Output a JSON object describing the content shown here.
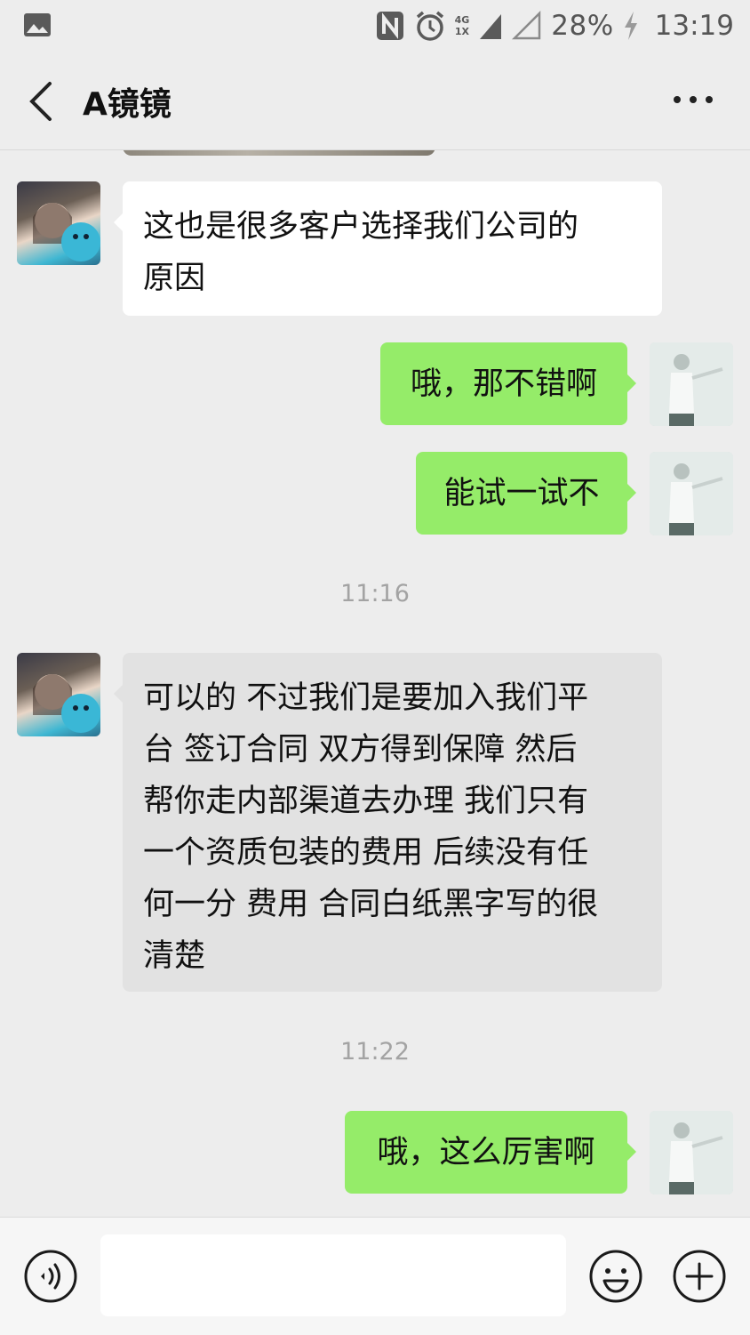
{
  "status_bar": {
    "network_label_top": "4G",
    "network_label_bottom": "1X",
    "battery": "28%",
    "time": "13:19",
    "icons": [
      "gallery-icon",
      "nfc-icon",
      "alarm-icon",
      "signal-icon",
      "signal-empty-icon",
      "charging-icon"
    ]
  },
  "header": {
    "title": "A镜镜"
  },
  "messages": [
    {
      "from": "them",
      "text": "这也是很多客户选择我们公司的原因"
    },
    {
      "from": "me",
      "text": "哦，那不错啊"
    },
    {
      "from": "me",
      "text": "能试一试不"
    },
    {
      "timestamp": "11:16"
    },
    {
      "from": "them",
      "text": "可以的 不过我们是要加入我们平台 签订合同 双方得到保障 然后帮你走内部渠道去办理 我们只有一个资质包装的费用 后续没有任何一分 费用 合同白纸黑字写的很清楚"
    },
    {
      "timestamp": "11:22"
    },
    {
      "from": "me",
      "text": "哦，这么厉害啊"
    }
  ],
  "msg": {
    "m1_l1": "这也是很多客户选择我们公司的",
    "m1_l2": "原因",
    "m2": "哦，那不错啊",
    "m3": "能试一试不",
    "ts1": "11:16",
    "m4_l1": "可以的 不过我们是要加入我们平",
    "m4_l2": "台 签订合同 双方得到保障 然后",
    "m4_l3": "帮你走内部渠道去办理 我们只有",
    "m4_l4": "一个资质包装的费用 后续没有任",
    "m4_l5": "何一分 费用 合同白纸黑字写的很",
    "m4_l6": "清楚",
    "ts2": "11:22",
    "m5": "哦，这么厉害啊"
  },
  "input_bar": {
    "input_value": "",
    "buttons": [
      "voice-icon",
      "emoji-icon",
      "plus-icon"
    ]
  },
  "colors": {
    "background": "#ededed",
    "outgoing_bubble": "#95ec69",
    "incoming_bubble": "#ffffff",
    "timestamp_text": "#a3a3a3"
  }
}
